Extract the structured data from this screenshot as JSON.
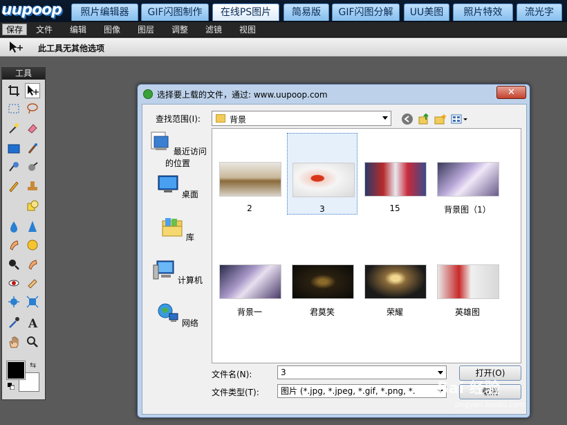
{
  "app": {
    "logo": "uupoop"
  },
  "top_tabs": [
    {
      "label": "照片编辑器"
    },
    {
      "label": "GIF闪图制作"
    },
    {
      "label": "在线PS图片"
    },
    {
      "label": "简易版"
    },
    {
      "label": "GIF闪图分解"
    },
    {
      "label": "UU美图"
    },
    {
      "label": "照片特效"
    },
    {
      "label": "流光字"
    }
  ],
  "active_tab": "在线PS图片",
  "menu": {
    "save": "保存",
    "items": [
      "文件",
      "编辑",
      "图像",
      "图层",
      "调整",
      "滤镜",
      "视图"
    ]
  },
  "option_bar": {
    "text": "此工具无其他选项"
  },
  "tools_panel": {
    "title": "工具"
  },
  "dialog": {
    "title": "选择要上载的文件，通过: www.uupoop.com",
    "close": "✕",
    "look_in_label": "查找范围(I):",
    "look_in_value": "背景",
    "places": [
      "最近访问的位置",
      "桌面",
      "库",
      "计算机",
      "网络"
    ],
    "files": [
      "2",
      "3",
      "15",
      "背景图（1）",
      "背景一",
      "君莫笑",
      "荣耀",
      "英雄图"
    ],
    "selected_file": "3",
    "filename_label": "文件名(N):",
    "filename_value": "3",
    "filetype_label": "文件类型(T):",
    "filetype_value": "图片 (*.jpg, *.jpeg, *.gif, *.png, *.",
    "open_button": "打开(O)",
    "cancel_button": "取消"
  },
  "watermark": {
    "main": "Bai 经验",
    "sub": "jingyan.baidu.com"
  },
  "colors": {
    "topbar": "#0b1a2e",
    "tab": "#a8d2f6",
    "dialog_frame": "#bdd2ea",
    "close": "#c2422c"
  }
}
